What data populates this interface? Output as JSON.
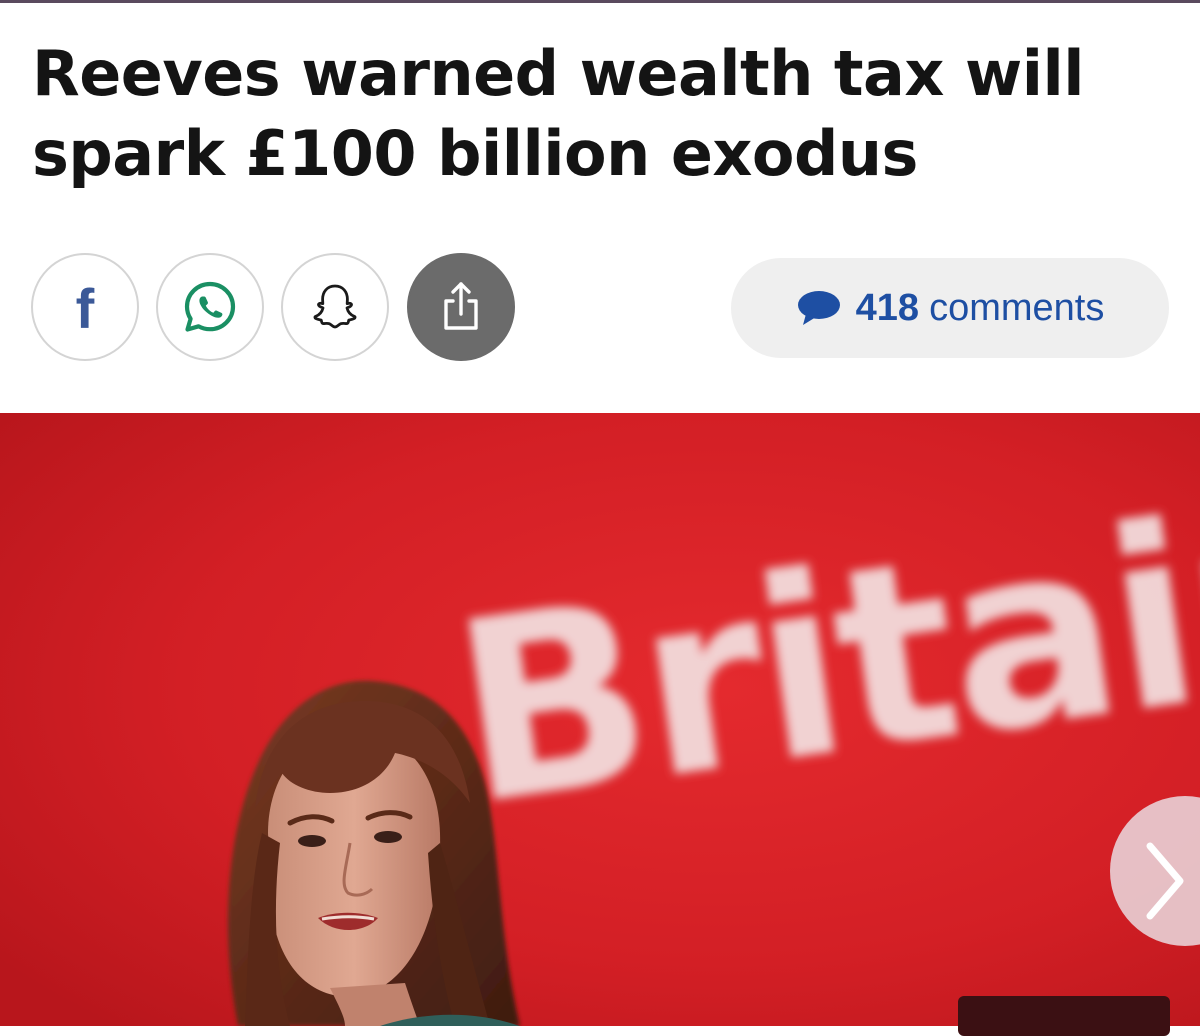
{
  "article": {
    "headline": "Reeves warned wealth tax will spark £100 billion exodus"
  },
  "share_bar": {
    "buttons": [
      {
        "icon": "facebook-icon",
        "glyph": "f"
      },
      {
        "icon": "whatsapp-icon"
      },
      {
        "icon": "snapchat-icon"
      },
      {
        "icon": "share-icon"
      }
    ],
    "comments": {
      "icon": "speech-bubble-icon",
      "count": "418",
      "label": "comments"
    }
  },
  "hero_image": {
    "backdrop_text": "Britain",
    "next_control": "chevron-right-icon"
  },
  "colors": {
    "headline": "#141414",
    "facebook_blue": "#3b5998",
    "whatsapp_green": "#1a8f63",
    "comments_blue": "#1e4fa3",
    "pill_background": "#efefef",
    "share_background": "#6b6b6b",
    "backdrop_red": "#d31f25"
  }
}
